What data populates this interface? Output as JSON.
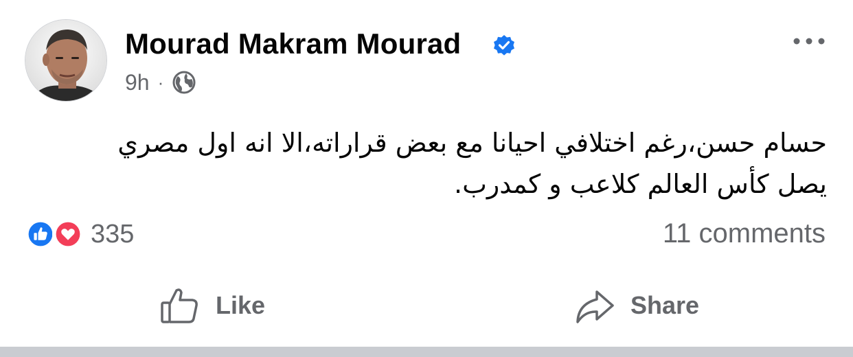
{
  "post": {
    "author": "Mourad Makram Mourad",
    "timestamp": "9h",
    "separator": "·",
    "audience_icon": "globe-icon",
    "verified_icon": "verified-badge-icon",
    "more_icon": "more-options-icon",
    "text_line_1": "حسام حسن،رغم اختلافي احيانا مع بعض قراراته،الا انه اول مصري",
    "text_line_2": "يصل كأس العالم كلاعب و كمدرب.",
    "reactions": {
      "icons": [
        "like-reaction-icon",
        "love-reaction-icon"
      ],
      "count": "335"
    },
    "comments": "11 comments",
    "actions": {
      "like_label": "Like",
      "share_label": "Share"
    }
  },
  "colors": {
    "text": "#050505",
    "secondary_text": "#65676b",
    "brand_blue": "#1877f2",
    "love_red": "#f33e58",
    "divider": "#c9ccd1"
  }
}
